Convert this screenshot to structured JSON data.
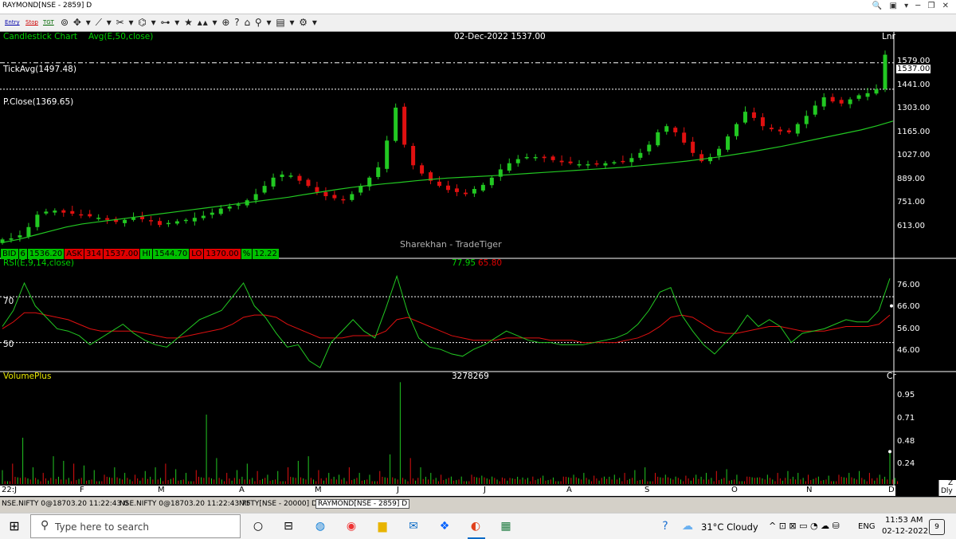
{
  "window": {
    "title": "RAYMOND[NSE - 2859] D"
  },
  "toolbar": {
    "entry_label": "Entry",
    "stop_label": "Stop",
    "tgt_label": "TGT"
  },
  "chart": {
    "header_left": "Candlestick Chart",
    "header_avg": "Avg(E,50,close)",
    "header_center": "02-Dec-2022 1537.00",
    "header_right": "Lnr",
    "tick_avg": "TickAvg(1497.48)",
    "prev_close": "P.Close(1369.65)",
    "watermark": "Sharekhan - TradeTiger",
    "last_price": "1537.00",
    "price_axis": [
      "1579.00",
      "1441.00",
      "1303.00",
      "1165.00",
      "1027.00",
      "889.00",
      "751.00",
      "613.00"
    ],
    "quote_bar": [
      {
        "label": "BID",
        "value": "6"
      },
      {
        "label": "",
        "value": "1536.20"
      },
      {
        "label": "ASK",
        "value": "314"
      },
      {
        "label": "",
        "value": "1537.00"
      },
      {
        "label": "HI",
        "value": "1544.70"
      },
      {
        "label": "LO",
        "value": "1370.00"
      },
      {
        "label": "%",
        "value": "12.22"
      }
    ],
    "rsi_title": "RSI(E,9,14,close)",
    "rsi_value_a": "77.95",
    "rsi_value_b": "65.80",
    "rsi_level_70": "70",
    "rsi_level_50": "50",
    "rsi_axis": [
      "76.00",
      "66.00",
      "56.00",
      "46.00"
    ],
    "vol_title": "VolumePlus",
    "vol_value": "3278269",
    "vol_right": "Cr",
    "vol_axis": [
      "0.95",
      "0.71",
      "0.48",
      "0.24"
    ],
    "x_labels": [
      "22:J",
      "F",
      "M",
      "A",
      "M",
      "J",
      "J",
      "A",
      "S",
      "O",
      "N",
      "D"
    ],
    "x_right": "Dly",
    "x_right_top": "Z"
  },
  "chart_data": {
    "type": "candlestick",
    "series": [
      {
        "name": "Candlestick Chart",
        "values": [
          640,
          645,
          660,
          700,
          760,
          775,
          780,
          770,
          765,
          760,
          752,
          745,
          735,
          725,
          735,
          745,
          738,
          728,
          710,
          720,
          728,
          735,
          745,
          755,
          770,
          790,
          800,
          810,
          830,
          860,
          900,
          940,
          955,
          950,
          925,
          900,
          870,
          850,
          840,
          830,
          860,
          900,
          940,
          990,
          1120,
          1280,
          1100,
          1000,
          960,
          925,
          900,
          880,
          870,
          860,
          885,
          905,
          940,
          980,
          1010,
          1030,
          1040,
          1040,
          1035,
          1025,
          1015,
          1010,
          1005,
          1005,
          1005,
          1010,
          1015,
          1020,
          1035,
          1060,
          1100,
          1160,
          1190,
          1160,
          1110,
          1060,
          1020,
          1040,
          1080,
          1140,
          1200,
          1260,
          1230,
          1190,
          1175,
          1165,
          1160,
          1200,
          1240,
          1290,
          1330,
          1310,
          1300,
          1320,
          1340,
          1350,
          1370,
          1537
        ]
      },
      {
        "name": "Avg(E,50,close)",
        "values": [
          625,
          640,
          660,
          680,
          700,
          715,
          725,
          735,
          745,
          755,
          765,
          775,
          785,
          795,
          805,
          815,
          825,
          835,
          845,
          858,
          870,
          882,
          893,
          902,
          910,
          917,
          925,
          932,
          938,
          942,
          946,
          950,
          955,
          960,
          965,
          970,
          975,
          980,
          985,
          990,
          997,
          1004,
          1012,
          1020,
          1030,
          1040,
          1052,
          1064,
          1078,
          1092,
          1108,
          1124,
          1140,
          1156,
          1172,
          1192,
          1215
        ]
      }
    ],
    "rsi": {
      "fast": [
        57,
        64,
        76,
        66,
        61,
        56,
        55,
        53,
        49,
        52,
        55,
        58,
        54,
        51,
        49,
        48,
        52,
        56,
        60,
        62,
        64,
        70,
        76,
        66,
        61,
        54,
        48,
        49,
        42,
        39,
        50,
        55,
        60,
        55,
        52,
        65,
        79,
        63,
        52,
        48,
        47,
        45,
        44,
        47,
        49,
        52,
        55,
        53,
        51,
        50,
        50,
        49,
        49,
        49,
        50,
        51,
        52,
        54,
        58,
        64,
        72,
        74,
        62,
        55,
        49,
        45,
        50,
        55,
        62,
        57,
        60,
        57,
        50,
        54,
        55,
        56,
        58,
        60,
        59,
        59,
        64,
        78
      ],
      "slow": [
        56,
        59,
        63,
        63,
        62,
        61,
        60,
        58,
        56,
        55,
        55,
        55,
        55,
        54,
        53,
        52,
        52,
        53,
        54,
        55,
        56,
        58,
        61,
        62,
        62,
        61,
        58,
        56,
        54,
        52,
        52,
        52,
        53,
        53,
        53,
        55,
        60,
        61,
        59,
        57,
        55,
        53,
        52,
        51,
        51,
        51,
        52,
        52,
        52,
        52,
        51,
        51,
        51,
        50,
        50,
        50,
        50,
        51,
        52,
        54,
        57,
        61,
        62,
        61,
        58,
        55,
        54,
        54,
        55,
        56,
        57,
        57,
        56,
        55,
        55,
        55,
        56,
        57,
        57,
        57,
        58,
        62
      ]
    },
    "volume": [
      0.15,
      0.22,
      0.5,
      0.18,
      0.12,
      0.3,
      0.25,
      0.22,
      0.2,
      0.15,
      0.1,
      0.18,
      0.12,
      0.1,
      0.14,
      0.18,
      0.22,
      0.16,
      0.12,
      0.15,
      0.75,
      0.28,
      0.12,
      0.15,
      0.22,
      0.14,
      0.1,
      0.14,
      0.18,
      0.25,
      0.3,
      0.15,
      0.12,
      0.1,
      0.18,
      0.12,
      0.1,
      0.14,
      0.32,
      1.1,
      0.28,
      0.18,
      0.12,
      0.1,
      0.08,
      0.08,
      0.1,
      0.09,
      0.08,
      0.07,
      0.06,
      0.07,
      0.08,
      0.09,
      0.07,
      0.08,
      0.1,
      0.12,
      0.09,
      0.08,
      0.1,
      0.12,
      0.15,
      0.18,
      0.12,
      0.1,
      0.08,
      0.09,
      0.1,
      0.12,
      0.14,
      0.16,
      0.1,
      0.08,
      0.07,
      0.1,
      0.12,
      0.14,
      0.12,
      0.1,
      0.08,
      0.09,
      0.1,
      0.12,
      0.14,
      0.12,
      0.1,
      0.35
    ],
    "y_axis_price": [
      "1579.00",
      "1441.00",
      "1303.00",
      "1165.00",
      "1027.00",
      "889.00",
      "751.00",
      "613.00"
    ],
    "y_axis_rsi": [
      "76.00",
      "66.00",
      "56.00",
      "46.00"
    ],
    "y_axis_volume": [
      "0.95",
      "0.71",
      "0.48",
      "0.24"
    ],
    "x_labels": [
      "22:J",
      "F",
      "M",
      "A",
      "M",
      "J",
      "J",
      "A",
      "S",
      "O",
      "N",
      "D"
    ]
  },
  "status_bar": {
    "items": [
      "NSE.NIFTY 0@18703.20 11:22:43 0",
      "NSE.NIFTY 0@18703.20 11:22:43 75",
      "NIFTY[NSE - 20000] D",
      "RAYMOND[NSE - 2859] D"
    ]
  },
  "taskbar": {
    "search_placeholder": "Type here to search",
    "weather": "31°C  Cloudy",
    "lang": "ENG",
    "time": "11:53 AM",
    "date": "02-12-2022",
    "notif_count": "9"
  }
}
